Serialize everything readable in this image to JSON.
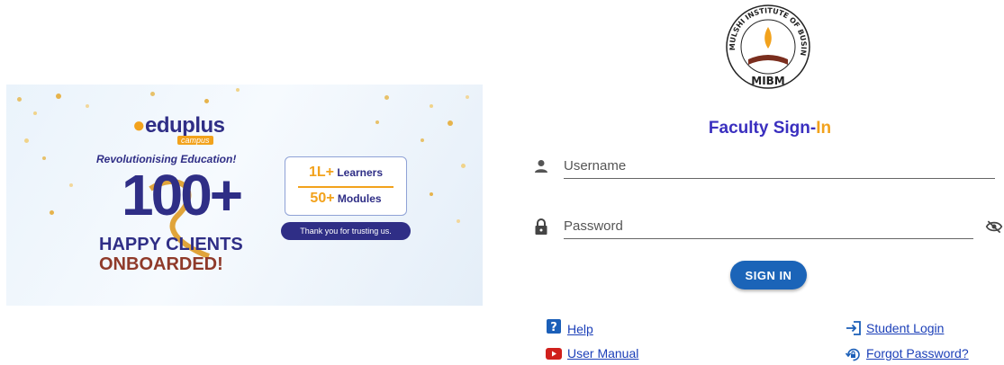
{
  "banner": {
    "brand": "eduplus",
    "brand_sub": "campus",
    "tagline": "Revolutionising Education!",
    "clients_count": "100+",
    "happy_clients": "HAPPY CLIENTS",
    "onboarded": "ONBOARDED!",
    "stat_learners_value": "1L+",
    "stat_learners_label": " Learners",
    "stat_modules_value": "50+",
    "stat_modules_label": " Modules",
    "thanks": "Thank you for trusting us."
  },
  "logo": {
    "top_text": "MULSHI INSTITUTE OF BUSINESS MANAGEMENT",
    "abbr": "MIBM"
  },
  "signin": {
    "title_main": "Faculty Sign-",
    "title_accent": "In",
    "username_placeholder": "Username",
    "password_placeholder": "Password",
    "button_label": "SIGN IN"
  },
  "links": {
    "help": "Help",
    "user_manual": "User Manual",
    "student_login": "Student Login",
    "forgot_password": "Forgot Password?"
  },
  "colors": {
    "primary_button": "#1b64b8",
    "title": "#3a2fbf",
    "accent": "#f2a21c",
    "link": "#1b3fb8"
  }
}
